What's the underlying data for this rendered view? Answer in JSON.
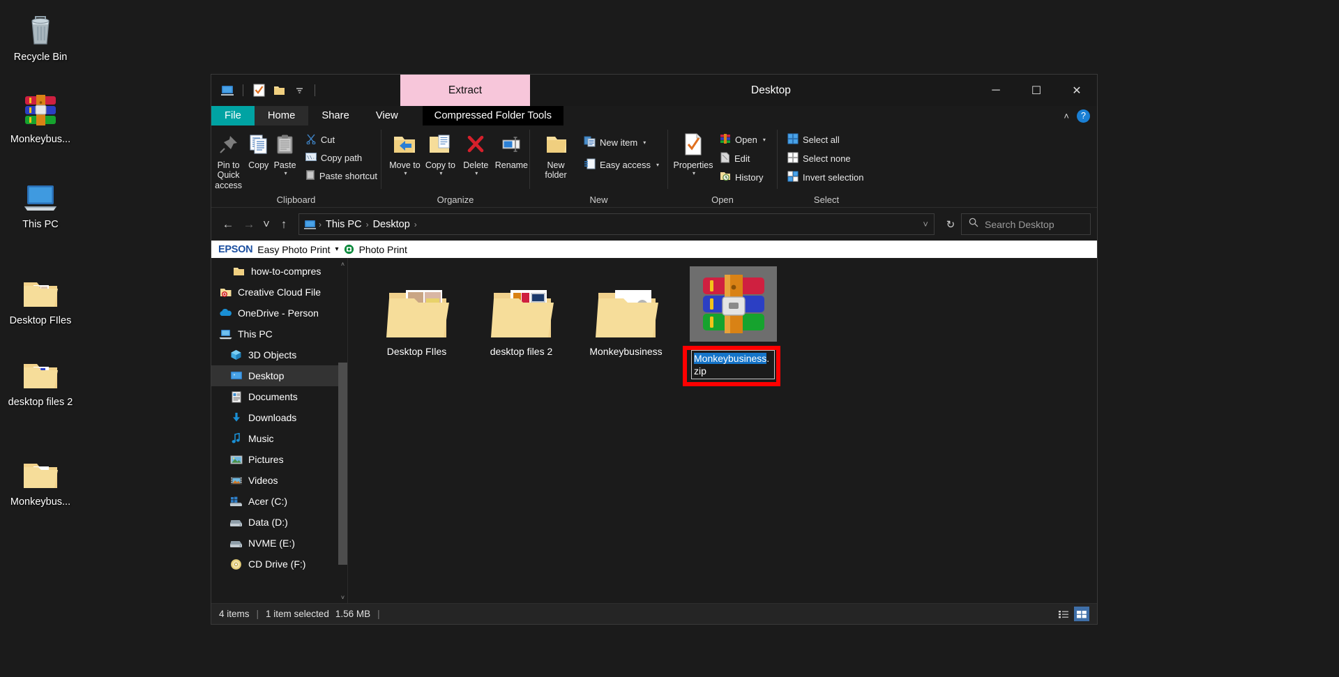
{
  "desktop": {
    "icons": [
      {
        "name": "Recycle Bin",
        "icon": "recycle-bin-icon"
      },
      {
        "name": "Monkeybus...",
        "icon": "winrar-archive-icon"
      },
      {
        "name": "This PC",
        "icon": "this-pc-icon"
      },
      {
        "name": "Desktop FIles",
        "icon": "folder-icon"
      },
      {
        "name": "desktop files 2",
        "icon": "folder-icon"
      },
      {
        "name": "Monkeybus...",
        "icon": "folder-icon"
      }
    ]
  },
  "window": {
    "title": "Desktop",
    "quick_access": [
      "explorer-icon",
      "properties-icon",
      "new-folder-icon",
      "customize-caret-icon"
    ],
    "contextual_tab": "Extract",
    "controls": {
      "minimize": "─",
      "maximize": "☐",
      "close": "✕"
    },
    "tabs": [
      {
        "label": "File",
        "state": "file"
      },
      {
        "label": "Home",
        "state": "active"
      },
      {
        "label": "Share",
        "state": "normal"
      },
      {
        "label": "View",
        "state": "normal"
      }
    ],
    "contextual_group_label": "Compressed Folder Tools",
    "help_label": "?",
    "collapse_label": "˄"
  },
  "ribbon": {
    "groups": [
      {
        "label": "Clipboard",
        "big_buttons": [
          {
            "label": "Pin to Quick access",
            "icon": "pin-icon"
          },
          {
            "label": "Copy",
            "icon": "copy-icon"
          },
          {
            "label": "Paste",
            "icon": "paste-icon",
            "caret": true
          }
        ],
        "small_buttons": [
          {
            "label": "Cut",
            "icon": "scissors-icon"
          },
          {
            "label": "Copy path",
            "icon": "copy-path-icon"
          },
          {
            "label": "Paste shortcut",
            "icon": "paste-shortcut-icon"
          }
        ]
      },
      {
        "label": "Organize",
        "big_buttons": [
          {
            "label": "Move to",
            "icon": "move-to-icon",
            "caret": true
          },
          {
            "label": "Copy to",
            "icon": "copy-to-icon",
            "caret": true
          },
          {
            "label": "Delete",
            "icon": "delete-icon",
            "caret": true
          },
          {
            "label": "Rename",
            "icon": "rename-icon"
          }
        ],
        "small_buttons": []
      },
      {
        "label": "New",
        "big_buttons": [
          {
            "label": "New folder",
            "icon": "new-folder-icon"
          }
        ],
        "small_buttons": [
          {
            "label": "New item",
            "icon": "new-item-icon",
            "caret": true
          },
          {
            "label": "Easy access",
            "icon": "easy-access-icon",
            "caret": true
          }
        ]
      },
      {
        "label": "Open",
        "big_buttons": [
          {
            "label": "Properties",
            "icon": "properties-icon",
            "caret": true
          }
        ],
        "small_buttons": [
          {
            "label": "Open",
            "icon": "winrar-open-icon",
            "caret": true
          },
          {
            "label": "Edit",
            "icon": "edit-icon"
          },
          {
            "label": "History",
            "icon": "history-icon"
          }
        ]
      },
      {
        "label": "Select",
        "big_buttons": [],
        "small_buttons": [
          {
            "label": "Select all",
            "icon": "select-all-icon"
          },
          {
            "label": "Select none",
            "icon": "select-none-icon"
          },
          {
            "label": "Invert selection",
            "icon": "invert-selection-icon"
          }
        ]
      }
    ]
  },
  "address_bar": {
    "back": "←",
    "forward": "→",
    "recent": "˅",
    "up": "↑",
    "breadcrumbs": [
      "This PC",
      "Desktop"
    ],
    "separator": "›",
    "dropdown": "˅",
    "refresh": "↻",
    "search_placeholder": "Search Desktop",
    "search_value": ""
  },
  "epson_bar": {
    "logo": "EPSON",
    "app": "Easy Photo Print",
    "caret": "▾",
    "action": "Photo Print"
  },
  "nav_pane": {
    "items": [
      {
        "label": "how-to-compres",
        "icon": "folder-icon",
        "indent": 1,
        "selected": false
      },
      {
        "label": "Creative Cloud File",
        "icon": "creative-cloud-icon",
        "indent": 0,
        "selected": false
      },
      {
        "label": "OneDrive - Person",
        "icon": "onedrive-icon",
        "indent": 0,
        "selected": false
      },
      {
        "label": "This PC",
        "icon": "this-pc-icon",
        "indent": 0,
        "selected": false
      },
      {
        "label": "3D Objects",
        "icon": "3d-objects-icon",
        "indent": 1,
        "selected": false
      },
      {
        "label": "Desktop",
        "icon": "desktop-icon",
        "indent": 1,
        "selected": true
      },
      {
        "label": "Documents",
        "icon": "documents-icon",
        "indent": 1,
        "selected": false
      },
      {
        "label": "Downloads",
        "icon": "downloads-icon",
        "indent": 1,
        "selected": false
      },
      {
        "label": "Music",
        "icon": "music-icon",
        "indent": 1,
        "selected": false
      },
      {
        "label": "Pictures",
        "icon": "pictures-icon",
        "indent": 1,
        "selected": false
      },
      {
        "label": "Videos",
        "icon": "videos-icon",
        "indent": 1,
        "selected": false
      },
      {
        "label": "Acer (C:)",
        "icon": "windows-drive-icon",
        "indent": 1,
        "selected": false
      },
      {
        "label": "Data (D:)",
        "icon": "drive-icon",
        "indent": 1,
        "selected": false
      },
      {
        "label": "NVME (E:)",
        "icon": "drive-icon",
        "indent": 1,
        "selected": false
      },
      {
        "label": "CD Drive (F:)",
        "icon": "cd-drive-icon",
        "indent": 1,
        "selected": false
      }
    ],
    "scroll_up": "˄",
    "scroll_down": "˅"
  },
  "files": [
    {
      "name": "Desktop FIles",
      "icon": "folder-thumbnail-icon",
      "renaming": false
    },
    {
      "name": "desktop files 2",
      "icon": "folder-thumbnail-icon",
      "renaming": false
    },
    {
      "name": "Monkeybusiness",
      "icon": "folder-thumbnail-icon",
      "renaming": false
    },
    {
      "name": "Monkeybusiness.zip",
      "icon": "winrar-archive-icon",
      "renaming": true,
      "rename_selected": "Monkeybusiness",
      "rename_unselected": ".zip"
    }
  ],
  "status_bar": {
    "item_count": "4 items",
    "selection": "1 item selected",
    "size": "1.56 MB",
    "sep": "|",
    "views": [
      {
        "icon": "details-view-icon",
        "active": false
      },
      {
        "icon": "large-icons-view-icon",
        "active": true
      }
    ]
  },
  "colors": {
    "file_tab": "#00a3a3",
    "extract_tab": "#f7c6da",
    "highlight": "#1574c8",
    "annotation": "#ff0000"
  }
}
